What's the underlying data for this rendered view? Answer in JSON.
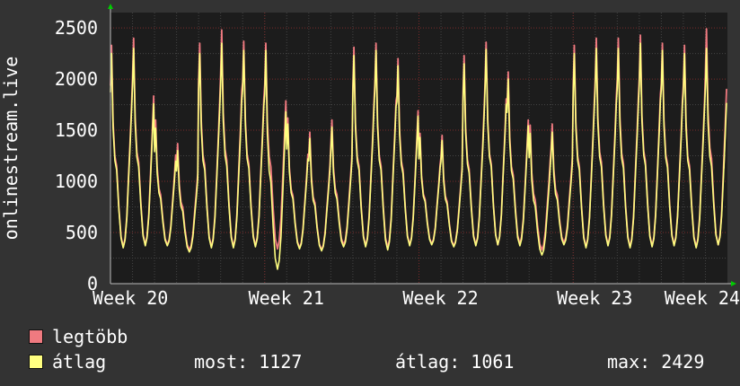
{
  "chart_data": {
    "type": "line",
    "ylabel": "onlinestream.live",
    "ylim": [
      0,
      2650
    ],
    "yticks": [
      0,
      500,
      1000,
      1500,
      2000,
      2500
    ],
    "x_tick_labels": [
      "Week 20",
      "Week 21",
      "Week 22",
      "Week 23",
      "Week 24"
    ],
    "grid": true,
    "days_count": 28,
    "series": [
      {
        "name": "legtöbb",
        "color": "#f07a80",
        "values": [
          2330,
          2400,
          1600,
          1370,
          2350,
          2480,
          2370,
          2350,
          1620,
          1480,
          1600,
          2310,
          2350,
          2200,
          1470,
          1450,
          2230,
          2360,
          2070,
          1550,
          1560,
          2330,
          2400,
          2400,
          2430,
          2350,
          2330,
          2490
        ],
        "mins": [
          360,
          380,
          380,
          330,
          360,
          360,
          370,
          340,
          350,
          330,
          380,
          370,
          350,
          380,
          390,
          370,
          380,
          380,
          390,
          330,
          400,
          360,
          380,
          360,
          370,
          380,
          360,
          380
        ]
      },
      {
        "name": "átlag",
        "color": "#ffff80",
        "values": [
          2250,
          2300,
          1520,
          1300,
          2250,
          2350,
          2280,
          2280,
          1560,
          1420,
          1530,
          2230,
          2280,
          2130,
          1430,
          1400,
          2150,
          2290,
          2000,
          1470,
          1480,
          2250,
          2300,
          2300,
          2350,
          2280,
          2250,
          2300
        ],
        "mins": [
          350,
          370,
          370,
          310,
          350,
          350,
          360,
          140,
          340,
          320,
          360,
          360,
          330,
          370,
          380,
          360,
          370,
          380,
          370,
          280,
          380,
          350,
          370,
          350,
          360,
          370,
          350,
          380
        ]
      }
    ],
    "last_value": 1127
  },
  "legend": {
    "max_label": "legtöbb",
    "avg_label": "átlag"
  },
  "stats": {
    "now_label": "most:",
    "now_value": "1127",
    "avg_label": "átlag:",
    "avg_value": "1061",
    "max_label": "max:",
    "max_value": "2429"
  },
  "colors": {
    "background": "#333333",
    "plot_background": "#1c1c1c",
    "grid_major": "#7a2a2a",
    "grid_minor": "#444444",
    "arrow": "#00cc00"
  }
}
